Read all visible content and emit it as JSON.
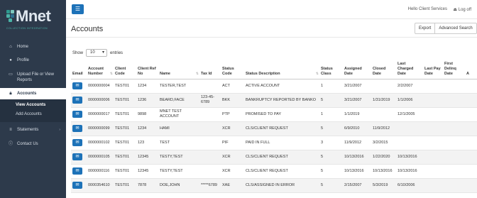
{
  "brand": {
    "logo_text": "Mnet",
    "tagline": "COLLECTION INTEGRATION",
    "logo_colors": [
      "#2e9a8f",
      "#4ab3a7",
      "#7cc8bf",
      "#2e6f8f"
    ]
  },
  "sidebar": {
    "items": [
      {
        "label": "Home",
        "icon": "home-icon"
      },
      {
        "label": "Profile",
        "icon": "user-icon"
      },
      {
        "label": "Upload File or View Reports",
        "icon": "file-icon"
      },
      {
        "label": "Accounts",
        "icon": "lock-icon"
      },
      {
        "label": "Statements",
        "icon": "list-icon"
      },
      {
        "label": "Contact Us",
        "icon": "info-icon"
      }
    ],
    "submenu": [
      {
        "label": "View Accounts"
      },
      {
        "label": "Add Accounts"
      }
    ]
  },
  "topbar": {
    "menu_icon": "☰",
    "greeting": "Hello Client Services",
    "logout_label": "Log off"
  },
  "header": {
    "title": "Accounts",
    "export_label": "Export",
    "advanced_search_label": "Advanced Search"
  },
  "entries": {
    "show_label": "Show",
    "selected": "10",
    "suffix": "entries"
  },
  "table": {
    "columns": [
      "Email",
      "Account Number",
      "Client Code",
      "Client Ref No",
      "Name",
      "Tax Id",
      "Status Code",
      "Status Description",
      "Status Class",
      "Assigned Date",
      "Closed Date",
      "Last Charged Date",
      "Last Pay Date",
      "First Delinq Date",
      "A"
    ],
    "rows": [
      [
        "",
        "0000000004",
        "TEST01",
        "1234",
        "TESTER,TEST",
        "",
        "ACT",
        "ACTIVE ACCOUNT",
        "1",
        "3/21/2007",
        "",
        "2/2/2007",
        "",
        "",
        ""
      ],
      [
        "",
        "0000000006",
        "TEST01",
        "1236",
        "BEARD,FACE",
        "123-45-6789",
        "BKK",
        "BANKRUPTCY REPORTED BY BANKO",
        "5",
        "3/21/2007",
        "1/31/2019",
        "1/1/2006",
        "",
        "",
        ""
      ],
      [
        "",
        "0000000017",
        "TEST01",
        "9898",
        "MNET TEST ACCOUNT",
        "",
        "PTP",
        "PROMISED TO PAY",
        "1",
        "1/1/2019",
        "",
        "12/1/2005",
        "",
        "",
        ""
      ],
      [
        "",
        "0000000099",
        "TEST01",
        "1234",
        "HAMI",
        "",
        "XCR",
        "CLS/CLIENT REQUEST",
        "5",
        "6/9/2010",
        "11/9/2012",
        "",
        "",
        "",
        ""
      ],
      [
        "",
        "0000000102",
        "TEST01",
        "123",
        "TEST",
        "",
        "PIF",
        "PAID IN FULL",
        "3",
        "11/9/2012",
        "3/2/2015",
        "",
        "",
        "",
        ""
      ],
      [
        "",
        "0000000105",
        "TEST01",
        "12345",
        "TESTY,TEST",
        "",
        "XCR",
        "CLS/CLIENT REQUEST",
        "5",
        "10/13/2016",
        "1/22/2020",
        "10/13/2016",
        "",
        "",
        ""
      ],
      [
        "",
        "0000000116",
        "TEST01",
        "12345",
        "TESTY,TEST",
        "",
        "XCR",
        "CLS/CLIENT REQUEST",
        "5",
        "10/13/2016",
        "10/13/2016",
        "10/13/2016",
        "",
        "",
        ""
      ],
      [
        "",
        "0000354610",
        "TEST01",
        "7878",
        "DOE,JOHN",
        "*****6789",
        "XAE",
        "CLS/ASSIGNED IN ERROR",
        "5",
        "2/15/2007",
        "5/3/2019",
        "6/10/2006",
        "",
        "",
        ""
      ]
    ]
  }
}
